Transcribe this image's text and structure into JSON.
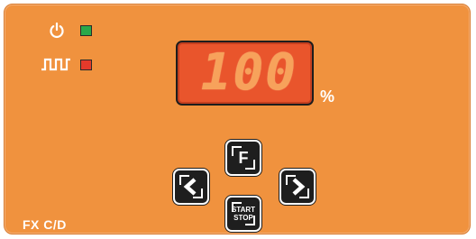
{
  "indicators": [
    {
      "name": "power",
      "icon": "power-icon",
      "led_color": "#2aa84a"
    },
    {
      "name": "pulse",
      "icon": "square-wave-icon",
      "led_color": "#e43a2b"
    }
  ],
  "display": {
    "value": "100",
    "unit": "%",
    "background_color": "#e9552c",
    "digit_color": "#f7a25b"
  },
  "buttons": {
    "f_label": "F",
    "left_icon": "chevron-left-icon",
    "right_icon": "chevron-right-icon",
    "startstop_line1": "START",
    "startstop_line2": "STOP"
  },
  "panel": {
    "model": "FX C/D",
    "background_color": "#f0923e"
  }
}
